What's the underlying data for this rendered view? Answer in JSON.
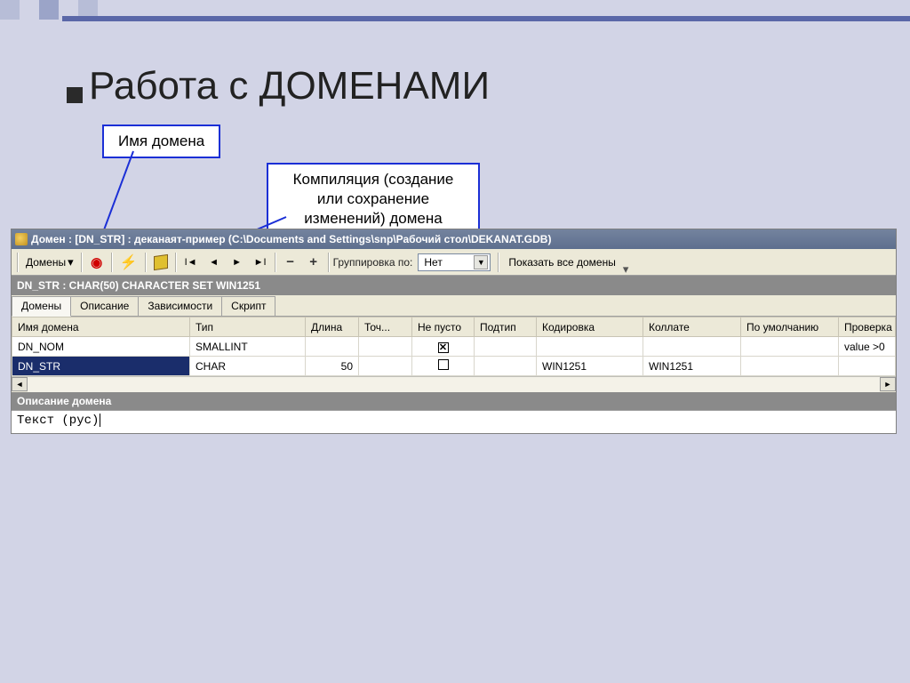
{
  "slide": {
    "title": "Работа с ДОМЕНАМИ",
    "callout_name": "Имя домена",
    "callout_compile": "Компиляция (создание или сохранение изменений) домена"
  },
  "window": {
    "title": "Домен : [DN_STR] : деканаят-пример (C:\\Documents and Settings\\snp\\Рабочий стол\\DEKANAT.GDB)",
    "tb_domains": "Домены",
    "tb_group_by": "Группировка по:",
    "tb_group_value": "Нет",
    "tb_show_all": "Показать все домены",
    "strip": "DN_STR : CHAR(50) CHARACTER SET WIN1251",
    "tabs": [
      "Домены",
      "Описание",
      "Зависимости",
      "Скрипт"
    ],
    "columns": [
      "Имя домена",
      "Тип",
      "Длина",
      "Точ...",
      "Не пусто",
      "Подтип",
      "Кодировка",
      "Коллате",
      "По умолчанию",
      "Проверка"
    ],
    "rows": [
      {
        "name": "DN_NOM",
        "type": "SMALLINT",
        "length": "",
        "prec": "",
        "notnull": true,
        "subtype": "",
        "encoding": "",
        "collate": "",
        "default": "",
        "check": "value >0"
      },
      {
        "name": "DN_STR",
        "type": "CHAR",
        "length": "50",
        "prec": "",
        "notnull": false,
        "subtype": "",
        "encoding": "WIN1251",
        "collate": "WIN1251",
        "default": "",
        "check": ""
      }
    ],
    "desc_label": "Описание домена",
    "desc_text": "Текст (рус)"
  }
}
